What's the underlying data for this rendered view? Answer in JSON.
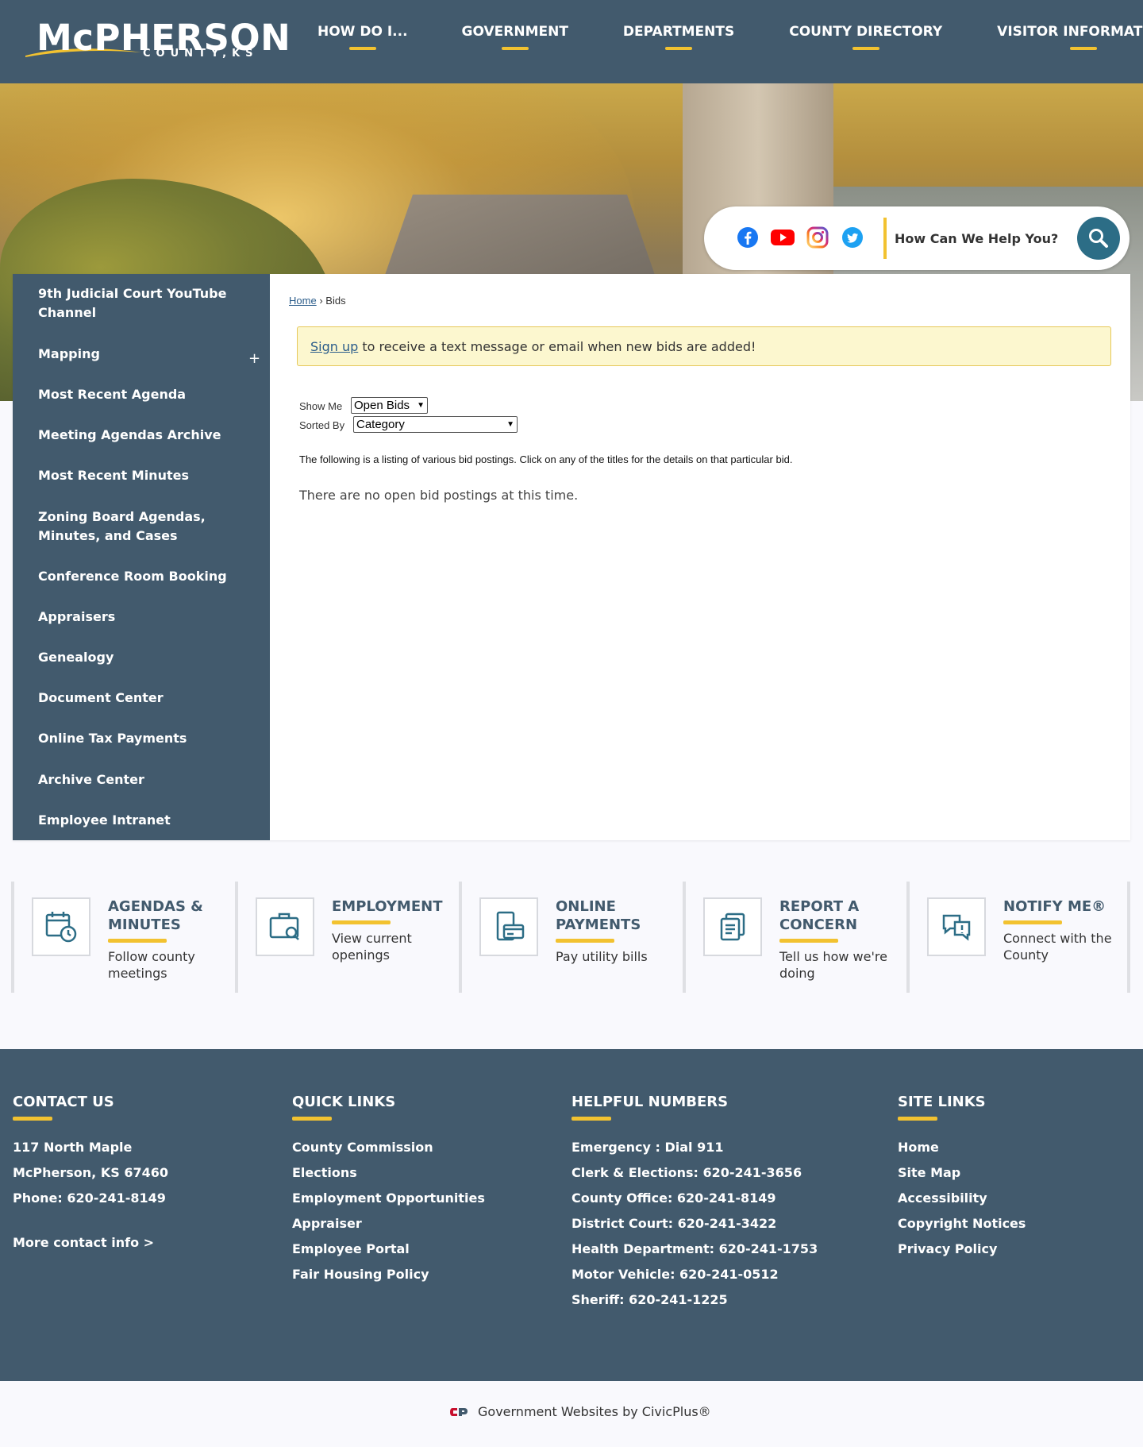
{
  "header": {
    "logo_main": "McPHERSON",
    "logo_sub": "COUNTY,KS",
    "nav": [
      "HOW DO I...",
      "GOVERNMENT",
      "DEPARTMENTS",
      "COUNTY DIRECTORY",
      "VISITOR INFORMATION"
    ],
    "accent": "#f2c230",
    "brand": "#425a6d"
  },
  "hero": {
    "social_icons": [
      "facebook-icon",
      "youtube-icon",
      "instagram-icon",
      "twitter-icon"
    ],
    "search_placeholder": "How Can We Help You?"
  },
  "sidebar": {
    "items": [
      {
        "label": "9th Judicial Court YouTube Channel"
      },
      {
        "label": "Mapping",
        "expand": "+"
      },
      {
        "label": "Most Recent Agenda"
      },
      {
        "label": "Meeting Agendas Archive"
      },
      {
        "label": "Most Recent Minutes"
      },
      {
        "label": "Zoning Board Agendas, Minutes, and Cases"
      },
      {
        "label": "Conference Room Booking"
      },
      {
        "label": "Appraisers"
      },
      {
        "label": "Genealogy"
      },
      {
        "label": "Document Center"
      },
      {
        "label": "Online Tax Payments"
      },
      {
        "label": "Archive Center"
      },
      {
        "label": "Employee Intranet"
      }
    ]
  },
  "main": {
    "breadcrumb": {
      "home": "Home",
      "separator": "›",
      "current": "Bids"
    },
    "alert": {
      "link": "Sign up",
      "text": " to receive a text message or email when new bids are added!"
    },
    "show_me": {
      "label": "Show Me",
      "value": "Open Bids"
    },
    "sorted_by": {
      "label": "Sorted By",
      "value": "Category"
    },
    "listing_note": "The following is a listing of various bid postings. Click on any of the titles for the details on that particular bid.",
    "no_bids": "There are no open bid postings at this time."
  },
  "quick_links": [
    {
      "title": "AGENDAS & MINUTES",
      "desc": "Follow county meetings",
      "icon": "calendar-clock-icon"
    },
    {
      "title": "EMPLOYMENT",
      "desc": "View current openings",
      "icon": "briefcase-search-icon"
    },
    {
      "title": "ONLINE PAYMENTS",
      "desc": "Pay utility bills",
      "icon": "payment-card-icon"
    },
    {
      "title": "REPORT A CONCERN",
      "desc": "Tell us how we're doing",
      "icon": "report-document-icon"
    },
    {
      "title": "NOTIFY ME®",
      "desc": "Connect with the County",
      "icon": "notify-bubble-icon"
    }
  ],
  "footer": {
    "contact": {
      "heading": "CONTACT US",
      "lines": [
        "117 North Maple",
        "McPherson, KS 67460",
        "Phone: 620-241-8149"
      ],
      "more": "More contact info >"
    },
    "quick_links": {
      "heading": "QUICK LINKS",
      "items": [
        "County Commission",
        "Elections",
        "Employment Opportunities",
        "Appraiser",
        "Employee Portal",
        "Fair Housing Policy"
      ]
    },
    "helpful_numbers": {
      "heading": "HELPFUL NUMBERS",
      "items": [
        "Emergency : Dial 911",
        "Clerk & Elections: 620-241-3656",
        "County Office: 620-241-8149",
        "District Court: 620-241-3422",
        "Health Department: 620-241-1753",
        "Motor Vehicle: 620-241-0512",
        "Sheriff: 620-241-1225"
      ]
    },
    "site_links": {
      "heading": "SITE LINKS",
      "items": [
        "Home",
        "Site Map",
        "Accessibility",
        "Copyright Notices",
        "Privacy Policy"
      ]
    },
    "credit": "Government Websites by CivicPlus®"
  }
}
